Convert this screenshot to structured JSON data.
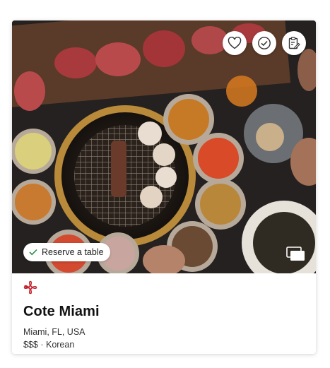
{
  "restaurant": {
    "name": "Cote Miami",
    "location": "Miami, FL, USA",
    "price": "$$$",
    "cuisine": "Korean",
    "distinction_icon": "michelin-flower-icon",
    "distinction_color": "#c4232f"
  },
  "photo": {
    "alt": "Korean barbecue table spread"
  },
  "actions": {
    "favorite_icon": "heart-outline-icon",
    "visited_icon": "check-circle-icon",
    "notes_icon": "clipboard-edit-icon"
  },
  "reserve": {
    "label": "Reserve a table",
    "icon": "check-icon",
    "icon_color": "#2b8a3e"
  },
  "gallery": {
    "icon": "gallery-stack-icon"
  }
}
